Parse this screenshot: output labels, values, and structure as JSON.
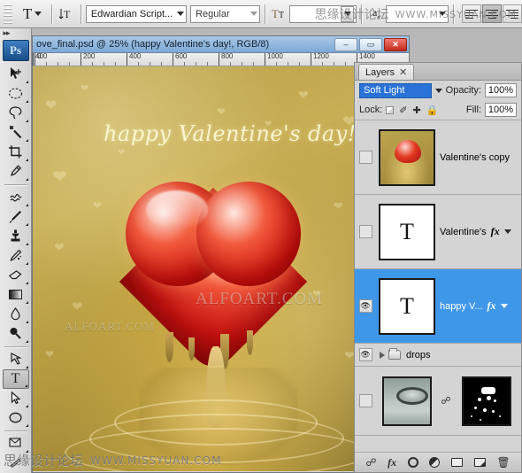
{
  "options_bar": {
    "tool_preset_icon": "type-tool-icon",
    "orientation_icon": "text-orientation-icon",
    "font_family": "Edwardian Script...",
    "font_style": "Regular",
    "font_size_icon": "font-size-icon",
    "font_size": "",
    "anti_alias_icon": "anti-alias-icon",
    "anti_alias": "",
    "align_left": "align-left",
    "align_center": "align-center",
    "align_right": "align-right"
  },
  "toolbox": {
    "expand_icon": "expand-chevrons-icon",
    "logo": "Ps",
    "tools": [
      {
        "name": "move-tool",
        "glyph": "⬌",
        "selected": false
      },
      {
        "name": "marquee-tool",
        "glyph": "◯",
        "selected": false
      },
      {
        "name": "lasso-tool",
        "glyph": "☂",
        "selected": false
      },
      {
        "name": "magic-wand-tool",
        "glyph": "✳",
        "selected": false
      },
      {
        "name": "crop-tool",
        "glyph": "⛏",
        "selected": false
      },
      {
        "name": "eyedropper-tool",
        "glyph": "✒",
        "selected": false
      },
      {
        "name": "healing-brush-tool",
        "glyph": "❁",
        "selected": false
      },
      {
        "name": "brush-tool",
        "glyph": "✐",
        "selected": false
      },
      {
        "name": "clone-stamp-tool",
        "glyph": "⚑",
        "selected": false
      },
      {
        "name": "history-brush-tool",
        "glyph": "✎",
        "selected": false
      },
      {
        "name": "eraser-tool",
        "glyph": "▱",
        "selected": false
      },
      {
        "name": "gradient-tool",
        "glyph": "■",
        "selected": false
      },
      {
        "name": "blur-tool",
        "glyph": "◕",
        "selected": false
      },
      {
        "name": "dodge-tool",
        "glyph": "⚲",
        "selected": false
      },
      {
        "name": "pen-tool",
        "glyph": "✑",
        "selected": false
      },
      {
        "name": "type-tool",
        "glyph": "T",
        "selected": true
      },
      {
        "name": "path-selection-tool",
        "glyph": "➤",
        "selected": false
      },
      {
        "name": "shape-tool",
        "glyph": "⬬",
        "selected": false
      },
      {
        "name": "notes-tool",
        "glyph": "⬚",
        "selected": false
      },
      {
        "name": "hand-tool",
        "glyph": "✋",
        "selected": false
      }
    ]
  },
  "document": {
    "title": "ove_final.psd @ 25% (happy Valentine's day!, RGB/8)",
    "zoom": "25%",
    "minimize_label": "–",
    "restore_label": "▭",
    "close_label": "✕",
    "ruler_ticks": [
      "0",
      "200",
      "400",
      "600",
      "800",
      "1000",
      "1200",
      "1400"
    ],
    "artwork": {
      "headline": "happy Valentine's day!",
      "watermark_main": "ALFOART.COM",
      "watermark_secondary": "ALFOART.COM"
    }
  },
  "layers_panel": {
    "tab_label": "Layers",
    "tab_close_icon": "close-icon",
    "blend_mode": "Soft Light",
    "opacity_label": "Opacity:",
    "opacity_value": "100%",
    "lock_label": "Lock:",
    "lock_icons": [
      "lock-transparency-icon",
      "lock-image-icon",
      "lock-position-icon",
      "lock-all-icon"
    ],
    "fill_label": "Fill:",
    "fill_value": "100%",
    "accent_color": "#3f97e8",
    "layers": [
      {
        "name": "Valentine's copy",
        "type": "image",
        "visible": false,
        "selected": false,
        "has_fx": false,
        "thumb_icon": "heart-artwork-thumbnail"
      },
      {
        "name": "Valentine's",
        "type": "text",
        "visible": false,
        "selected": false,
        "has_fx": true,
        "fx_label": "fx",
        "thumb_icon": "text-layer-thumbnail",
        "thumb_glyph": "T"
      },
      {
        "name": "happy V...",
        "type": "text",
        "visible": true,
        "selected": true,
        "has_fx": true,
        "fx_label": "fx",
        "thumb_icon": "text-layer-thumbnail",
        "thumb_glyph": "T"
      },
      {
        "name": "drops",
        "type": "group",
        "visible": true,
        "selected": false,
        "has_fx": false,
        "expand_icon": "chevron-right-icon",
        "folder_icon": "folder-icon"
      },
      {
        "name": "",
        "type": "masked-image",
        "visible": false,
        "selected": false,
        "has_fx": false,
        "link_icon": "link-icon",
        "thumb_icon": "water-drops-thumbnail",
        "mask_icon": "layer-mask-thumbnail"
      }
    ],
    "footer_buttons": [
      {
        "name": "link-layers-button",
        "glyph": "⚭"
      },
      {
        "name": "layer-style-button",
        "glyph": "fx"
      },
      {
        "name": "add-layer-mask-button",
        "glyph": "circle"
      },
      {
        "name": "new-adjustment-layer-button",
        "glyph": "half-circle"
      },
      {
        "name": "new-group-button",
        "glyph": "folder"
      },
      {
        "name": "new-layer-button",
        "glyph": "page"
      },
      {
        "name": "delete-layer-button",
        "glyph": "☒"
      }
    ]
  },
  "watermarks": {
    "bottom_cn": "思缘设计论坛",
    "bottom_en": "WWW.MISSYUAN.COM",
    "top_cn": "思缘设计论坛",
    "top_en": "WWW.MISSYUAN.COM"
  }
}
